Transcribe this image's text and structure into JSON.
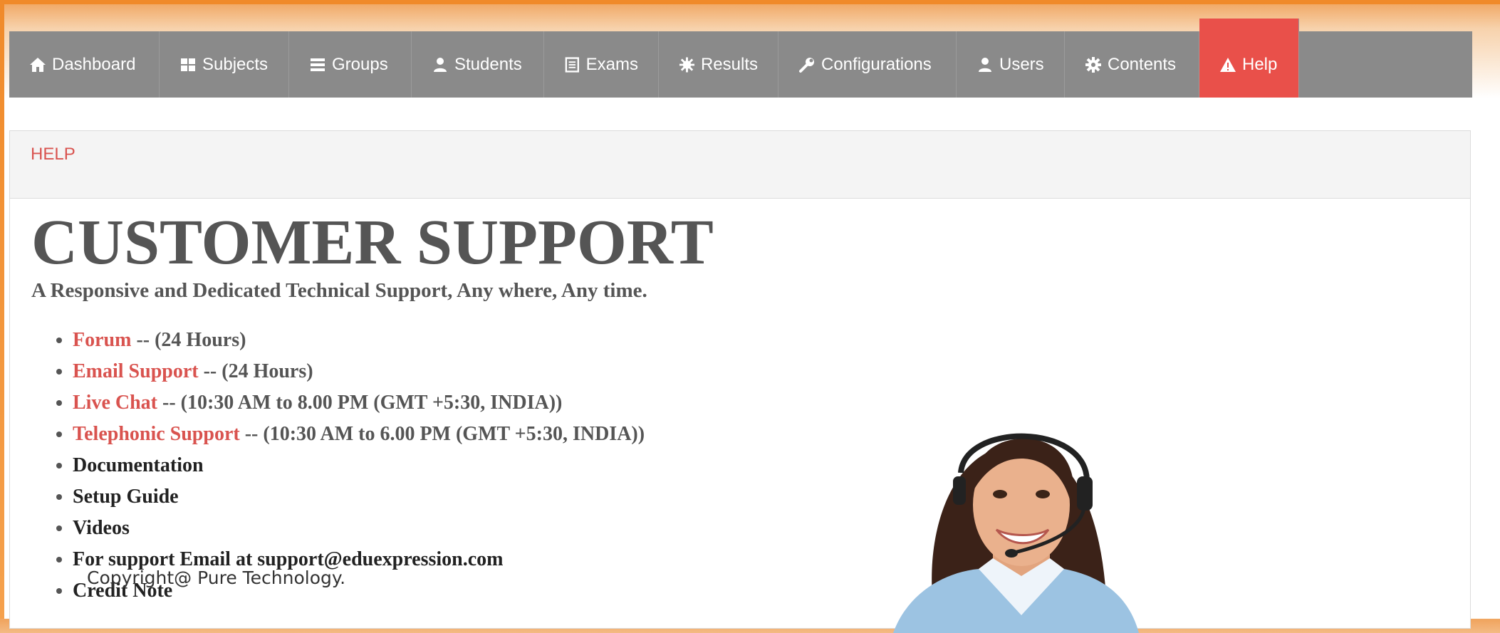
{
  "nav": {
    "items": [
      {
        "label": "Dashboard",
        "icon": "home-icon"
      },
      {
        "label": "Subjects",
        "icon": "grid-icon"
      },
      {
        "label": "Groups",
        "icon": "list-icon"
      },
      {
        "label": "Students",
        "icon": "user-icon"
      },
      {
        "label": "Exams",
        "icon": "document-icon"
      },
      {
        "label": "Results",
        "icon": "star-burst-icon"
      },
      {
        "label": "Configurations",
        "icon": "wrench-icon"
      },
      {
        "label": "Users",
        "icon": "user-icon"
      },
      {
        "label": "Contents",
        "icon": "gear-icon"
      },
      {
        "label": "Help",
        "icon": "warning-icon"
      }
    ],
    "active": "Help"
  },
  "panel": {
    "heading": "HELP"
  },
  "support": {
    "title": "CUSTOMER SUPPORT",
    "subtitle": "A Responsive and Dedicated Technical Support, Any where, Any time.",
    "items": [
      {
        "link": "Forum",
        "text": " -- (24 Hours)"
      },
      {
        "link": "Email Support",
        "text": " -- (24 Hours)"
      },
      {
        "link": "Live Chat",
        "text": " -- (10:30 AM to 8.00 PM (GMT +5:30, INDIA))"
      },
      {
        "link": "Telephonic Support",
        "text": " -- (10:30 AM to 6.00 PM (GMT +5:30, INDIA))"
      },
      {
        "text": "Documentation"
      },
      {
        "text": "Setup Guide"
      },
      {
        "text": "Videos"
      },
      {
        "text": "For support Email at support@eduexpression.com"
      },
      {
        "text": "Credit Note"
      }
    ]
  },
  "footer": {
    "copyright": "Copyright@ Pure Technology."
  },
  "colors": {
    "accent": "#e9504a",
    "nav": "#8a8a8a",
    "link": "#d9534f",
    "frame": "#f08a2a"
  }
}
